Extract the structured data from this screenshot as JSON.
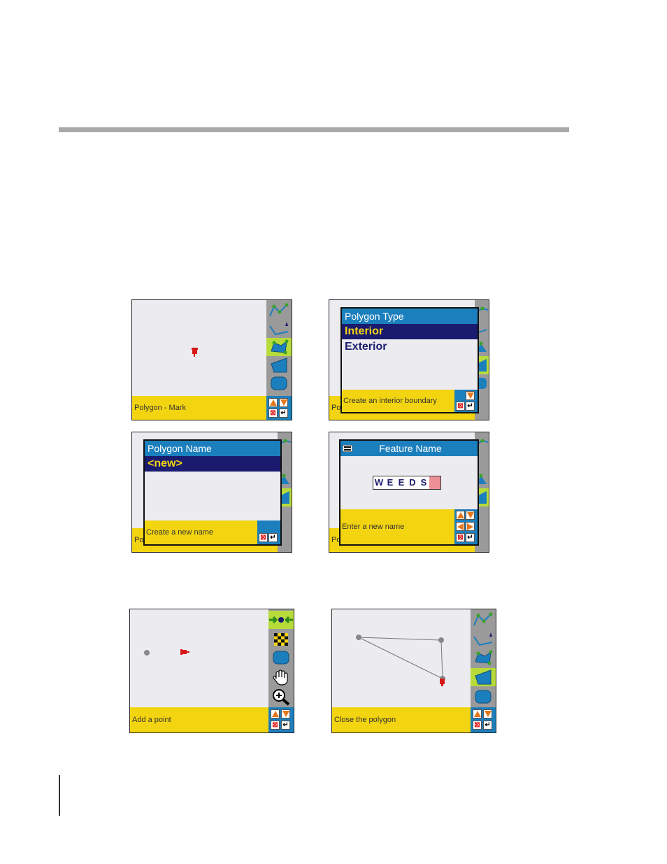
{
  "screens": {
    "s1": {
      "status": "Polygon - Mark"
    },
    "s2": {
      "title": "Polygon Type",
      "items": [
        "Interior",
        "Exterior"
      ],
      "status": "Create an interior boundary"
    },
    "s3": {
      "title": "Polygon Name",
      "items": [
        "<new>"
      ],
      "status": "Create a new name",
      "behind_status": "Pol"
    },
    "s4": {
      "title": "Feature Name",
      "letters": [
        "W",
        "E",
        "E",
        "D",
        "S"
      ],
      "status": "Enter a new name",
      "behind_status": "Pol"
    },
    "s5": {
      "status": "Add a point"
    },
    "s6": {
      "status": "Close the polygon"
    },
    "s2_behind_status": "Pol"
  },
  "icons": {
    "mark": "red-pushpin-icon",
    "line-tool": "polyline-icon",
    "polygon-tool": "polygon-icon",
    "area-tool": "area-icon",
    "boundary-tool": "boundary-icon",
    "add-point": "add-point-arrow-icon",
    "finish": "checkered-flag-icon",
    "pan": "hand-icon",
    "zoom": "zoom-in-icon"
  },
  "colors": {
    "status_bar": "#f3d411",
    "title_bar": "#1c7fbd",
    "selection": "#1a1a6e",
    "active_tool": "#b7dc3a"
  }
}
